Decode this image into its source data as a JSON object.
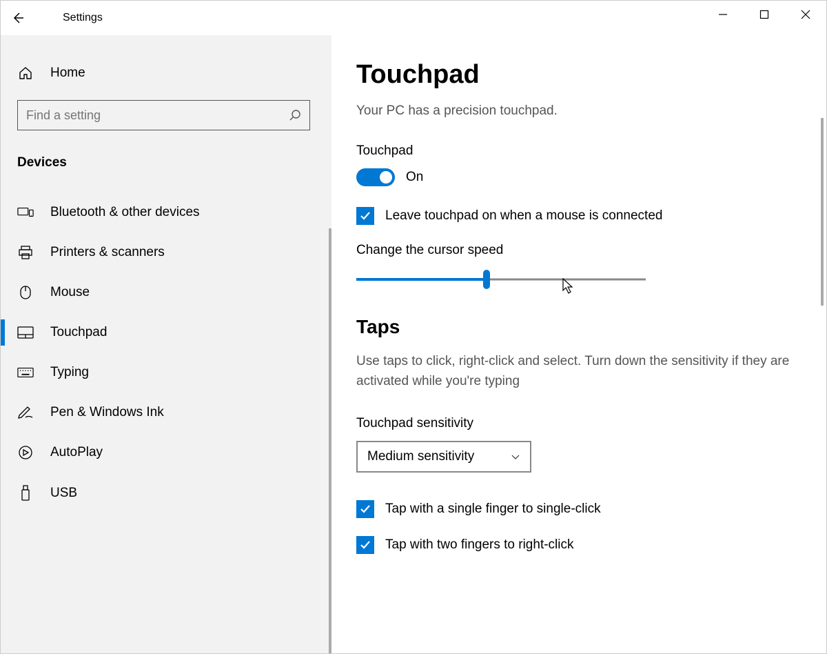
{
  "app": {
    "title": "Settings"
  },
  "sidebar": {
    "home": "Home",
    "search_placeholder": "Find a setting",
    "section": "Devices",
    "items": [
      {
        "label": "Bluetooth & other devices",
        "icon": "bluetooth-devices-icon",
        "active": false
      },
      {
        "label": "Printers & scanners",
        "icon": "printer-icon",
        "active": false
      },
      {
        "label": "Mouse",
        "icon": "mouse-icon",
        "active": false
      },
      {
        "label": "Touchpad",
        "icon": "touchpad-icon",
        "active": true
      },
      {
        "label": "Typing",
        "icon": "keyboard-icon",
        "active": false
      },
      {
        "label": "Pen & Windows Ink",
        "icon": "pen-icon",
        "active": false
      },
      {
        "label": "AutoPlay",
        "icon": "autoplay-icon",
        "active": false
      },
      {
        "label": "USB",
        "icon": "usb-icon",
        "active": false
      }
    ]
  },
  "main": {
    "page_title": "Touchpad",
    "precision_text": "Your PC has a precision touchpad.",
    "touchpad_heading": "Touchpad",
    "toggle_state": "On",
    "leave_on_label": "Leave touchpad on when a mouse is connected",
    "cursor_speed_label": "Change the cursor speed",
    "cursor_speed_percent": 45,
    "taps_title": "Taps",
    "taps_desc": "Use taps to click, right-click and select. Turn down the sensitivity if they are activated while you're typing",
    "sensitivity_label": "Touchpad sensitivity",
    "sensitivity_value": "Medium sensitivity",
    "tap_single": "Tap with a single finger to single-click",
    "tap_two": "Tap with two fingers to right-click"
  }
}
